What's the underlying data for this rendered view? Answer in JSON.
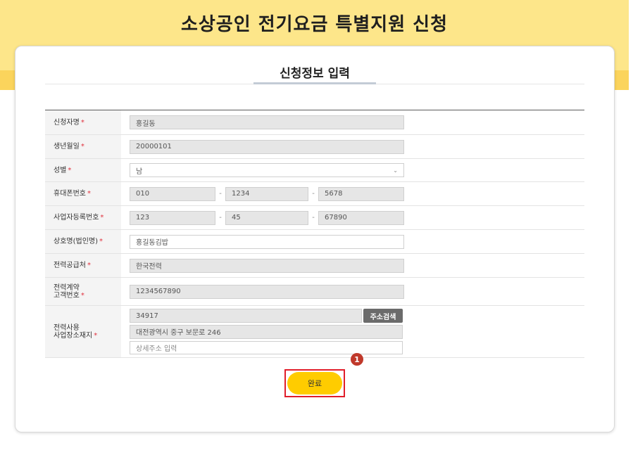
{
  "banner": {
    "title": "소상공인 전기요금 특별지원 신청"
  },
  "section": {
    "title": "신청정보 입력"
  },
  "required_mark": "*",
  "form": {
    "name": {
      "label": "신청자명",
      "value": "홍길동"
    },
    "birth": {
      "label": "생년월일",
      "value": "20000101"
    },
    "gender": {
      "label": "성별",
      "value": "남"
    },
    "phone": {
      "label": "휴대폰번호",
      "part1": "010",
      "part2": "1234",
      "part3": "5678",
      "separator": "-"
    },
    "bizno": {
      "label": "사업자등록번호",
      "part1": "123",
      "part2": "45",
      "part3": "67890",
      "separator": "-"
    },
    "company": {
      "label": "상호명(법인명)",
      "value": "홍길동김밥"
    },
    "supplier": {
      "label": "전력공급처",
      "value": "한국전력"
    },
    "customer_no": {
      "label_line1": "전력계약",
      "label_line2": "고객번호",
      "value": "1234567890"
    },
    "address": {
      "label_line1": "전력사용",
      "label_line2": "사업장소재지",
      "zipcode": "34917",
      "search_label": "주소검색",
      "base": "대전광역시 중구 보문로 246",
      "detail_placeholder": "상세주소 입력"
    }
  },
  "submit": {
    "label": "완료"
  },
  "step_badge": "1",
  "colors": {
    "accent": "#ffcc00",
    "highlight": "#e11d2a",
    "required": "#e0303c"
  }
}
